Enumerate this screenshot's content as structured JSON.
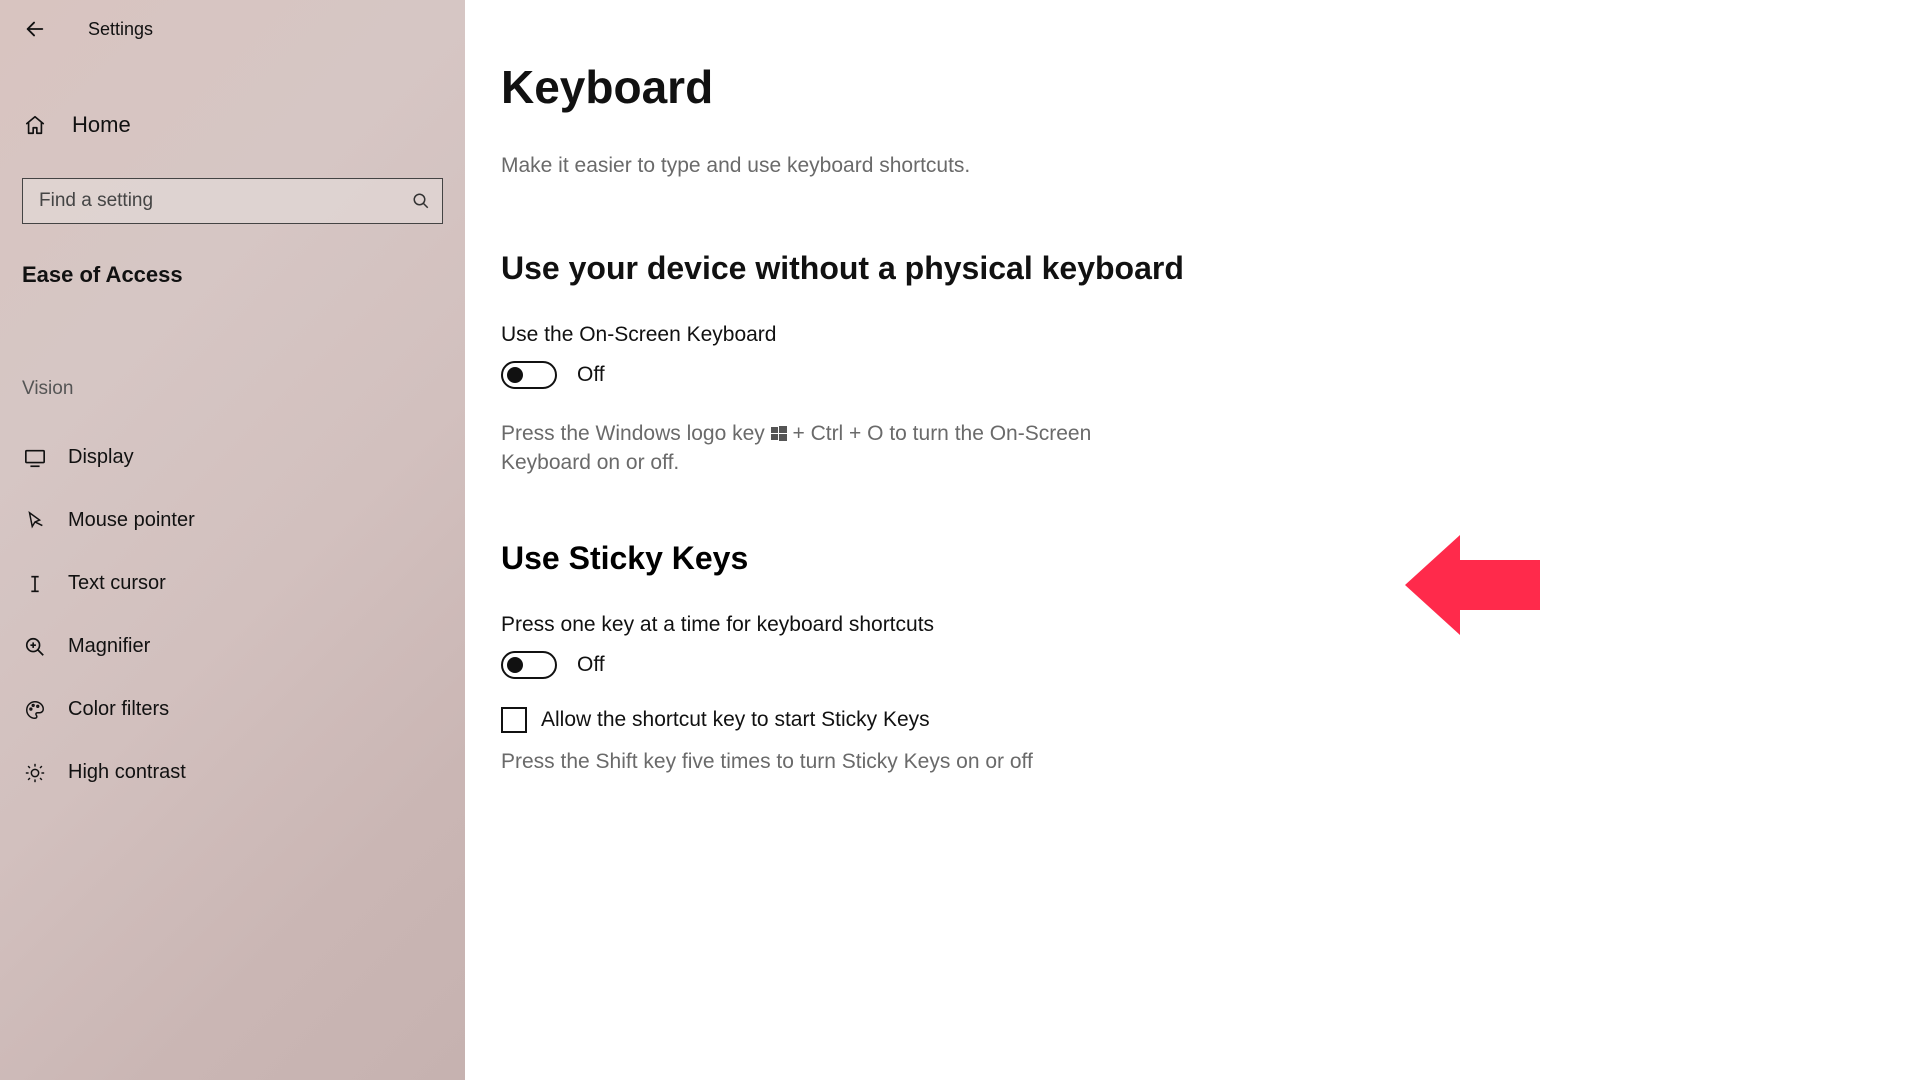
{
  "app": {
    "title": "Settings"
  },
  "sidebar": {
    "home": "Home",
    "search_placeholder": "Find a setting",
    "section": "Ease of Access",
    "group": "Vision",
    "items": [
      {
        "label": "Display"
      },
      {
        "label": "Mouse pointer"
      },
      {
        "label": "Text cursor"
      },
      {
        "label": "Magnifier"
      },
      {
        "label": "Color filters"
      },
      {
        "label": "High contrast"
      }
    ]
  },
  "page": {
    "title": "Keyboard",
    "subtitle": "Make it easier to type and use keyboard shortcuts."
  },
  "osk": {
    "heading": "Use your device without a physical keyboard",
    "label": "Use the On-Screen Keyboard",
    "state": "Off",
    "help_pre": "Press the Windows logo key ",
    "help_post": " + Ctrl + O to turn the On-Screen Keyboard on or off."
  },
  "sticky": {
    "heading": "Use Sticky Keys",
    "label": "Press one key at a time for keyboard shortcuts",
    "state": "Off",
    "checkbox_label": "Allow the shortcut key to start Sticky Keys",
    "help": "Press the Shift key five times to turn Sticky Keys on or off"
  }
}
